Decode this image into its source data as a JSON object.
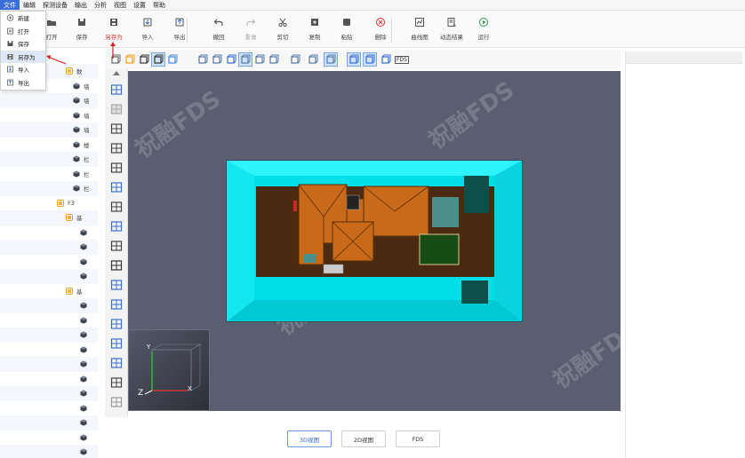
{
  "menubar": [
    "文件",
    "编辑",
    "探测设备",
    "输出",
    "分析",
    "视图",
    "设置",
    "帮助"
  ],
  "file_menu": {
    "items": [
      {
        "label": "新建",
        "icon": "new-icon"
      },
      {
        "label": "打开",
        "icon": "open-icon"
      },
      {
        "label": "保存",
        "icon": "save-icon"
      },
      {
        "label": "另存为",
        "icon": "save-as-icon",
        "highlighted": true
      },
      {
        "label": "导入",
        "icon": "import-icon"
      },
      {
        "label": "导出",
        "icon": "export-icon"
      }
    ]
  },
  "toolbar": {
    "buttons": [
      {
        "label": "打开",
        "icon": "open-folder-icon",
        "dim": false
      },
      {
        "label": "保存",
        "icon": "save-icon",
        "dim": false
      },
      {
        "label": "另存为",
        "icon": "save-as-icon",
        "dim": false,
        "red": true
      },
      {
        "label": "导入",
        "icon": "import-icon",
        "dim": false
      },
      {
        "label": "导出",
        "icon": "export-icon",
        "dim": false
      },
      {
        "label": "撤回",
        "icon": "undo-icon",
        "dim": false
      },
      {
        "label": "重做",
        "icon": "redo-icon",
        "dim": true
      },
      {
        "label": "剪切",
        "icon": "cut-icon",
        "dim": false
      },
      {
        "label": "复制",
        "icon": "copy-icon",
        "dim": false
      },
      {
        "label": "粘贴",
        "icon": "paste-icon",
        "dim": false
      },
      {
        "label": "删除",
        "icon": "delete-icon",
        "dim": false
      },
      {
        "label": "曲线图",
        "icon": "chart-icon",
        "dim": false
      },
      {
        "label": "动态结果",
        "icon": "dynamic-result-icon",
        "dim": false
      },
      {
        "label": "运行",
        "icon": "run-icon",
        "dim": false
      }
    ]
  },
  "tree": {
    "rows": [
      {
        "label": "数",
        "type": "folder"
      },
      {
        "label": "墙",
        "type": "box"
      },
      {
        "label": "墙",
        "type": "box"
      },
      {
        "label": "墙",
        "type": "box"
      },
      {
        "label": "墙",
        "type": "box"
      },
      {
        "label": "楼",
        "type": "box"
      },
      {
        "label": "栏",
        "type": "box"
      },
      {
        "label": "栏",
        "type": "box"
      },
      {
        "label": "栏",
        "type": "box"
      },
      {
        "label": "F3",
        "type": "folder"
      },
      {
        "label": "基",
        "type": "folder"
      },
      {
        "label": "",
        "type": "box"
      },
      {
        "label": "",
        "type": "box"
      },
      {
        "label": "",
        "type": "box"
      },
      {
        "label": "",
        "type": "box"
      },
      {
        "label": "基",
        "type": "folder"
      },
      {
        "label": "",
        "type": "box"
      },
      {
        "label": "",
        "type": "box"
      },
      {
        "label": "",
        "type": "box"
      },
      {
        "label": "",
        "type": "box"
      },
      {
        "label": "",
        "type": "box"
      },
      {
        "label": "",
        "type": "box"
      },
      {
        "label": "",
        "type": "box"
      },
      {
        "label": "",
        "type": "box"
      },
      {
        "label": "",
        "type": "box"
      },
      {
        "label": "",
        "type": "box"
      },
      {
        "label": "",
        "type": "box"
      },
      {
        "label": "",
        "type": "box"
      }
    ]
  },
  "axes": {
    "x": "X",
    "y": "Y",
    "z": "Z"
  },
  "view_tabs": [
    {
      "label": "3D视图",
      "active": true
    },
    {
      "label": "2D视图",
      "active": false
    },
    {
      "label": "FDS",
      "active": false
    }
  ],
  "watermark": "祝融FDS",
  "fds_tool_label": "FDS",
  "colors": {
    "accent": "#3a6fd8",
    "viewport_bg": "#5a5e70",
    "floor": "#00e5f0",
    "roof": "#c96a1a",
    "ground": "#4a2a10"
  }
}
